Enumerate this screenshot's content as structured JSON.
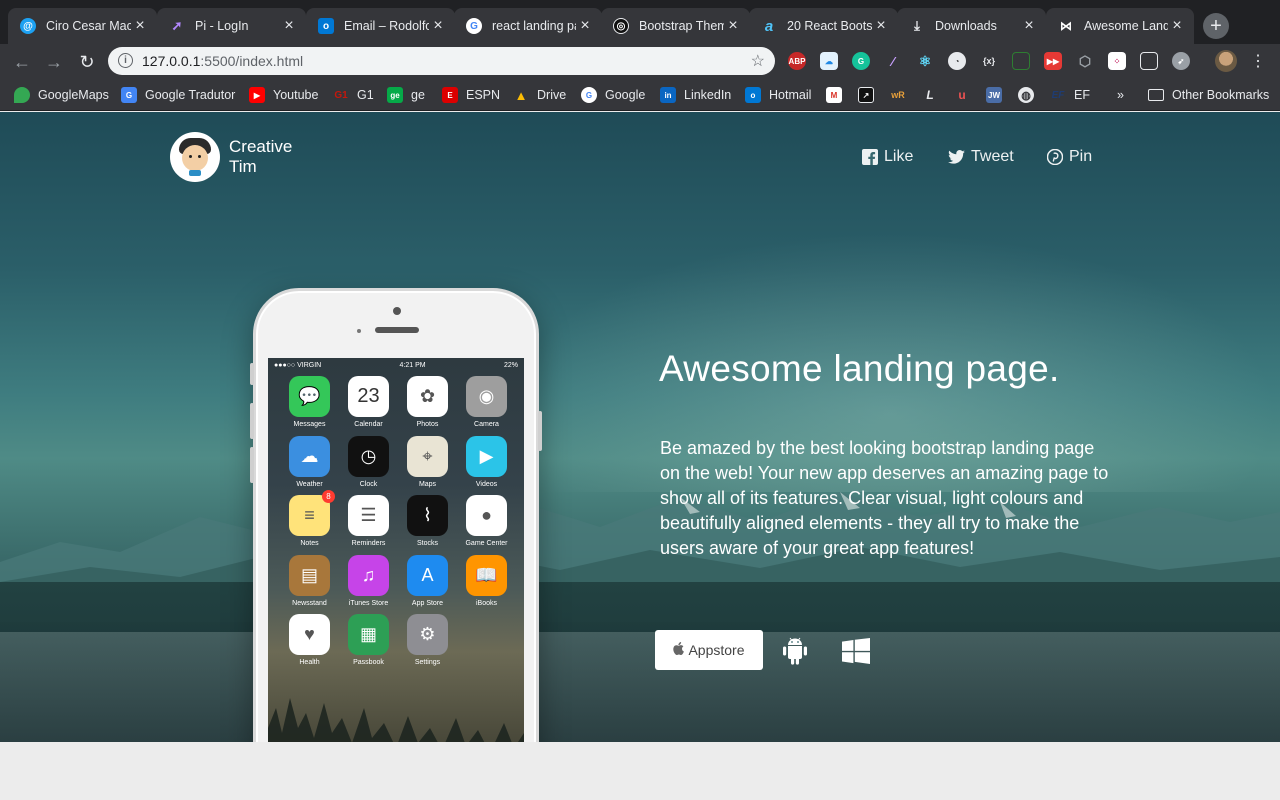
{
  "browser": {
    "tabs": [
      {
        "title": "Ciro Cesar Maci",
        "icon": "at-icon",
        "color": "#1da1f2"
      },
      {
        "title": "Pi - LogIn",
        "icon": "rocket-icon",
        "color": "#7c4dff"
      },
      {
        "title": "Email – Rodolfo",
        "icon": "outlook-icon",
        "color": "#0078d4"
      },
      {
        "title": "react landing pa",
        "icon": "google-icon",
        "color": "#ffffff"
      },
      {
        "title": "Bootstrap Them",
        "icon": "bootstrap-icon",
        "color": "#111111"
      },
      {
        "title": "20 React Boots",
        "icon": "a-icon",
        "color": "#1e88e5"
      },
      {
        "title": "Downloads",
        "icon": "download-icon",
        "color": "#e8eaed"
      },
      {
        "title": "Awesome Landi",
        "icon": "bow-tie-icon",
        "color": "#ffffff"
      }
    ],
    "new_tab": "+",
    "url_host": "127.0.0.1",
    "url_rest": ":5500/index.html",
    "bookmarks": [
      {
        "label": "GoogleMaps",
        "color": "#34a853"
      },
      {
        "label": "Google Tradutor",
        "color": "#4285f4"
      },
      {
        "label": "Youtube",
        "color": "#ff0000"
      },
      {
        "label": "G1",
        "color": "#c4170c"
      },
      {
        "label": "ge",
        "color": "#06aa48"
      },
      {
        "label": "ESPN",
        "color": "#d00"
      },
      {
        "label": "Drive",
        "color": "#fbbc04"
      },
      {
        "label": "Google",
        "color": "#ffffff"
      },
      {
        "label": "LinkedIn",
        "color": "#0a66c2"
      },
      {
        "label": "Hotmail",
        "color": "#0078d4"
      },
      {
        "label": "EF",
        "color": "#1a3e6f"
      },
      {
        "label": "»",
        "color": ""
      },
      {
        "label": "Other Bookmarks",
        "color": ""
      }
    ]
  },
  "page": {
    "brand": {
      "line1": "Creative",
      "line2": "Tim"
    },
    "share": {
      "like": "Like",
      "tweet": "Tweet",
      "pin": "Pin"
    },
    "headline": "Awesome landing page.",
    "description": "Be amazed by the best looking bootstrap landing page on the web! Your new app deserves an amazing page to show all of its features. Clear visual, light colours and beautifully aligned elements - they all try to make the users aware of your great app features!",
    "appstore_label": "Appstore",
    "phone": {
      "carrier": "●●●○○ VIRGIN",
      "time": "4:21 PM",
      "battery": "22%",
      "calendar_day": "23",
      "notes_badge": "8",
      "apps": [
        {
          "label": "Messages",
          "color": "#34c759",
          "glyph": "💬"
        },
        {
          "label": "Calendar",
          "color": "#ffffff",
          "glyph": ""
        },
        {
          "label": "Photos",
          "color": "#ffffff",
          "glyph": "✿"
        },
        {
          "label": "Camera",
          "color": "#9e9e9e",
          "glyph": "◉"
        },
        {
          "label": "Weather",
          "color": "#3b8fe0",
          "glyph": "☁"
        },
        {
          "label": "Clock",
          "color": "#111111",
          "glyph": "◷"
        },
        {
          "label": "Maps",
          "color": "#e9e4d4",
          "glyph": "⌖"
        },
        {
          "label": "Videos",
          "color": "#2bc4e8",
          "glyph": "▶"
        },
        {
          "label": "Notes",
          "color": "#ffe37a",
          "glyph": "≡"
        },
        {
          "label": "Reminders",
          "color": "#ffffff",
          "glyph": "☰"
        },
        {
          "label": "Stocks",
          "color": "#111111",
          "glyph": "⌇"
        },
        {
          "label": "Game Center",
          "color": "#ffffff",
          "glyph": "●"
        },
        {
          "label": "Newsstand",
          "color": "#a8773b",
          "glyph": "▤"
        },
        {
          "label": "iTunes Store",
          "color": "#c644e8",
          "glyph": "♫"
        },
        {
          "label": "App Store",
          "color": "#1e8bf0",
          "glyph": "A"
        },
        {
          "label": "iBooks",
          "color": "#ff9500",
          "glyph": "📖"
        },
        {
          "label": "Health",
          "color": "#ffffff",
          "glyph": "♥"
        },
        {
          "label": "Passbook",
          "color": "#2d9f55",
          "glyph": "▦"
        },
        {
          "label": "Settings",
          "color": "#8e8e93",
          "glyph": "⚙"
        }
      ]
    }
  }
}
